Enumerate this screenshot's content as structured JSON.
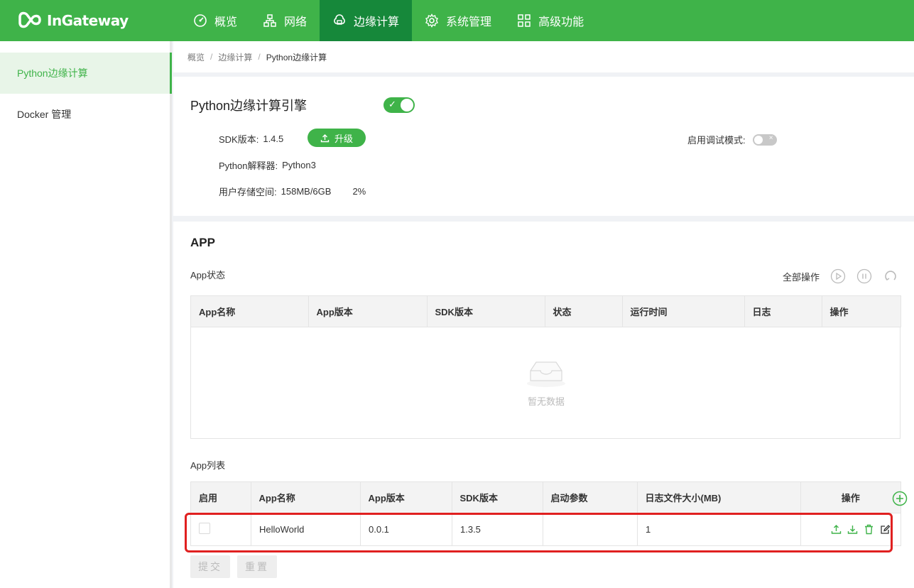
{
  "brand": {
    "name": "InGateway",
    "mark_text": "inhand"
  },
  "nav": {
    "items": [
      {
        "label": "概览",
        "icon": "dashboard-icon"
      },
      {
        "label": "网络",
        "icon": "network-icon"
      },
      {
        "label": "边缘计算",
        "icon": "edge-computing-icon",
        "active": true
      },
      {
        "label": "系统管理",
        "icon": "gear-icon"
      },
      {
        "label": "高级功能",
        "icon": "grid-icon"
      }
    ]
  },
  "sidebar": {
    "items": [
      {
        "label": "Python边缘计算",
        "active": true
      },
      {
        "label": "Docker 管理"
      }
    ]
  },
  "breadcrumb": [
    "概览",
    "边缘计算",
    "Python边缘计算"
  ],
  "breadcrumb_sep": "/",
  "engine": {
    "title": "Python边缘计算引擎",
    "enabled": true,
    "sdk_label": "SDK版本:",
    "sdk_value": "1.4.5",
    "upgrade_label": "升级",
    "interpreter_label": "Python解释器:",
    "interpreter_value": "Python3",
    "storage_label": "用户存储空间:",
    "storage_value": "158MB/6GB",
    "storage_percent": "2%",
    "debug_label": "启用调试模式:",
    "debug_enabled": false
  },
  "app": {
    "title": "APP",
    "status_title": "App状态",
    "all_ops_label": "全部操作",
    "status_table": {
      "columns": [
        "App名称",
        "App版本",
        "SDK版本",
        "状态",
        "运行时间",
        "日志",
        "操作"
      ],
      "empty_text": "暂无数据"
    },
    "list_title": "App列表",
    "list_table": {
      "columns": [
        "启用",
        "App名称",
        "App版本",
        "SDK版本",
        "启动参数",
        "日志文件大小(MB)",
        "操作"
      ],
      "rows": [
        {
          "enabled": false,
          "name": "HelloWorld",
          "app_version": "0.0.1",
          "sdk_version": "1.3.5",
          "params": "",
          "log_size": "1"
        }
      ]
    },
    "submit_label": "提交",
    "reset_label": "重置"
  },
  "colors": {
    "brand_green": "#3fb349",
    "active_nav": "#16883a",
    "highlight_red": "#e02020"
  }
}
